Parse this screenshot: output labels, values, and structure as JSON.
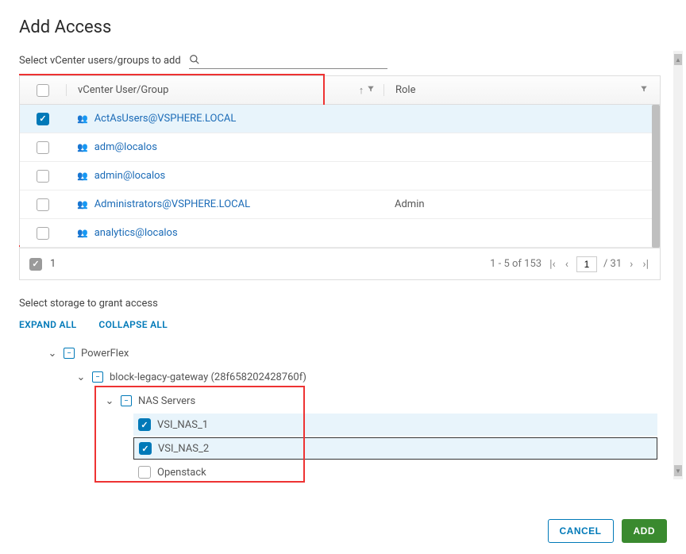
{
  "title": "Add Access",
  "select_users_label": "Select vCenter users/groups to add",
  "search": {
    "placeholder": ""
  },
  "table": {
    "header": {
      "user": "vCenter User/Group",
      "role": "Role"
    },
    "rows": [
      {
        "user": "ActAsUsers@VSPHERE.LOCAL",
        "role": "",
        "checked": true
      },
      {
        "user": "adm@localos",
        "role": "",
        "checked": false
      },
      {
        "user": "admin@localos",
        "role": "",
        "checked": false
      },
      {
        "user": "Administrators@VSPHERE.LOCAL",
        "role": "Admin",
        "checked": false
      },
      {
        "user": "analytics@localos",
        "role": "",
        "checked": false
      }
    ]
  },
  "pagination": {
    "selected_count": "1",
    "range": "1 - 5 of 153",
    "current_page": "1",
    "total_pages": "/ 31"
  },
  "storage_label": "Select storage to grant access",
  "tree_actions": {
    "expand": "EXPAND ALL",
    "collapse": "COLLAPSE ALL"
  },
  "tree": {
    "root": "PowerFlex",
    "gateway": "block-legacy-gateway (28f658202428760f)",
    "nas": "NAS Servers",
    "leaf1": "VSI_NAS_1",
    "leaf2": "VSI_NAS_2",
    "leaf3": "Openstack"
  },
  "footer": {
    "cancel": "CANCEL",
    "add": "ADD"
  }
}
